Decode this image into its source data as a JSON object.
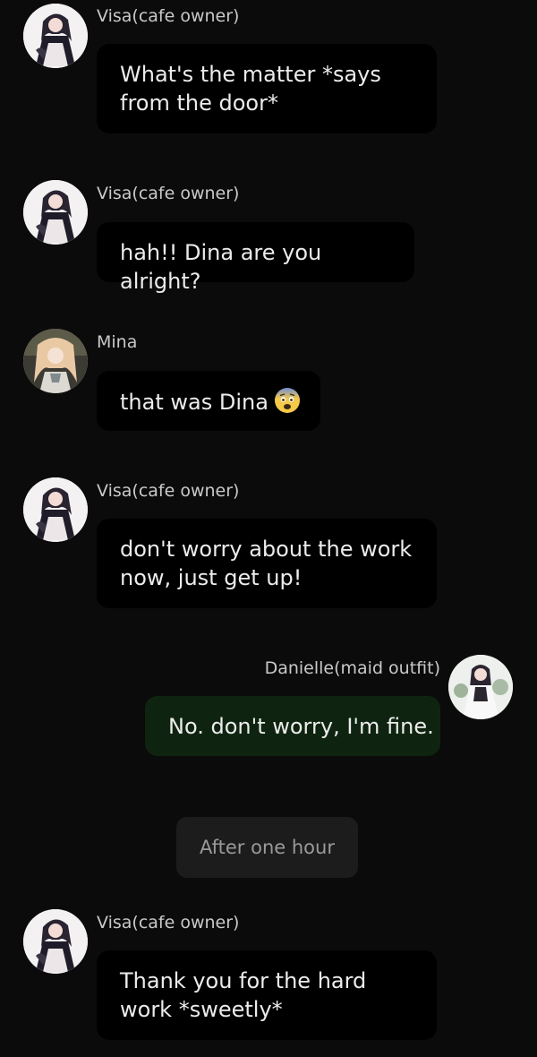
{
  "messages": [
    {
      "sender": "Visa(cafe owner)",
      "text": "What's the matter *says from the door*",
      "side": "left",
      "avatar": "visa-avatar"
    },
    {
      "sender": "Visa(cafe owner)",
      "text": "hah!! Dina are you alright?",
      "side": "left",
      "avatar": "visa-avatar"
    },
    {
      "sender": "Mina",
      "text": "that was Dina",
      "emoji": "fearful-face-emoji",
      "side": "left",
      "avatar": "mina-avatar"
    },
    {
      "sender": "Visa(cafe owner)",
      "text": "don't worry about the work now, just get up!",
      "side": "left",
      "avatar": "visa-avatar"
    },
    {
      "sender": "Danielle(maid outfit)",
      "text": "No. don't worry, I'm fine.",
      "side": "right",
      "avatar": "danielle-avatar"
    },
    {
      "sender": "Visa(cafe owner)",
      "text": "Thank you for the hard work *sweetly*",
      "side": "left",
      "avatar": "visa-avatar"
    }
  ],
  "divider": {
    "text": "After one hour"
  },
  "colors": {
    "background": "#0b0b0b",
    "bubble": "#000000",
    "own_bubble": "#0f2410",
    "name_text": "#c9c9c9",
    "message_text": "#ececec",
    "divider_pill": "#1c1c1c"
  }
}
